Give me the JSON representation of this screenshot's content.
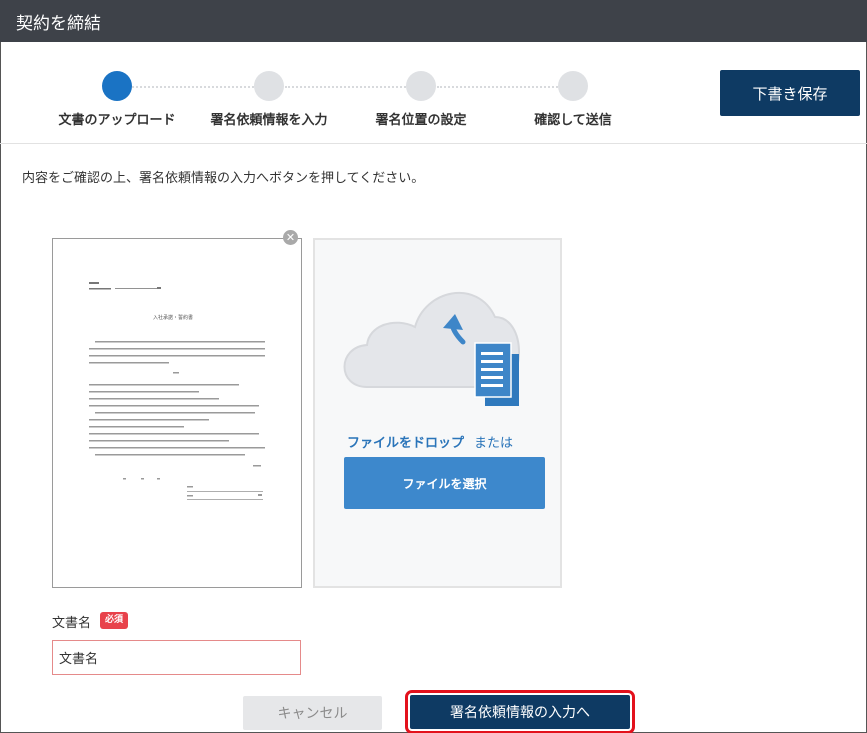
{
  "window": {
    "title": "契約を締結"
  },
  "steps": [
    {
      "label": "文書のアップロード",
      "active": true
    },
    {
      "label": "署名依頼情報を入力",
      "active": false
    },
    {
      "label": "署名位置の設定",
      "active": false
    },
    {
      "label": "確認して送信",
      "active": false
    }
  ],
  "toolbar": {
    "draft_label": "下書き保存"
  },
  "instruction": "内容をご確認の上、署名依頼情報の入力へボタンを押してください。",
  "preview": {
    "close_icon": "close-icon",
    "heading": "入社承諾・誓約書"
  },
  "dropzone": {
    "drop_text": "ファイルをドロップ",
    "or_text": "または",
    "select_label": "ファイルを選択",
    "icon": "cloud-upload-icon"
  },
  "docname": {
    "label": "文書名",
    "required": "必須",
    "value": "文書名"
  },
  "actions": {
    "cancel_label": "キャンセル",
    "next_label": "署名依頼情報の入力へ"
  },
  "colors": {
    "titlebar": "#3e4249",
    "primary": "#0e3a63",
    "accent": "#1a73c4",
    "highlight": "#e3111c",
    "required": "#e8424b"
  }
}
